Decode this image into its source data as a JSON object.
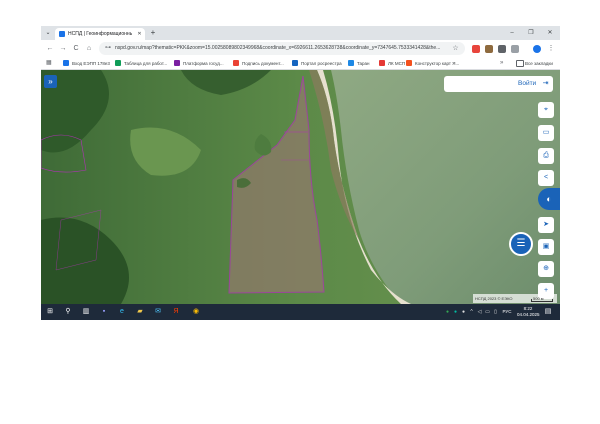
{
  "browser": {
    "tab": {
      "title": "НСПД | Геоинформационный",
      "close": "✕"
    },
    "new_tab": "+",
    "search_tabs": "⌄",
    "window": {
      "minimize": "–",
      "maximize": "❐",
      "close": "✕"
    },
    "nav": {
      "back": "←",
      "forward": "→",
      "reload": "C",
      "home": "⌂"
    },
    "address": {
      "icon": "⊶",
      "url": "nspd.gov.ru/map?thematic=PKK&zoom=15.00258089802349968&coordinate_x=6926611.2653628738&coordinate_y=7347645.7533341428&the...",
      "star": "☆"
    },
    "extensions": [
      "#e8453c",
      "#8e6a3e",
      "#5f6368",
      "#9aa0a6",
      "#1a73e8"
    ],
    "bookmarks": [
      {
        "label": "Вход ЕЭПП 178e3",
        "color": "#1a73e8"
      },
      {
        "label": "Таблица для работ...",
        "color": "#0f9d58"
      },
      {
        "label": "Платформа госуд...",
        "color": "#7b1fa2"
      },
      {
        "label": "Подпись документ...",
        "color": "#ea4335"
      },
      {
        "label": "Портал росреестра",
        "color": "#1565c0"
      },
      {
        "label": "Таран",
        "color": "#1e88e5"
      },
      {
        "label": "ЛК МСП",
        "color": "#e53935"
      },
      {
        "label": "Конструктор карт Я...",
        "color": "#f4511e"
      }
    ],
    "bookmarks_more": "»",
    "other_bookmarks": "Все закладки"
  },
  "map": {
    "expand_icon": "»",
    "login": {
      "label": "Войти",
      "icon": "⇥"
    },
    "tools": [
      {
        "name": "location-tool",
        "icon": "⌖"
      },
      {
        "name": "layers-tool",
        "icon": "▭"
      },
      {
        "name": "print-tool",
        "icon": "⎙"
      },
      {
        "name": "share-tool",
        "icon": "<"
      },
      {
        "name": "navigate-tool",
        "icon": "➤"
      },
      {
        "name": "image-tool",
        "icon": "▣"
      },
      {
        "name": "search-map-tool",
        "icon": "⊕"
      },
      {
        "name": "zoom-in-tool",
        "icon": "+"
      }
    ],
    "chat_icon": "☰",
    "side_panel_icon": "◐",
    "scale_text": "НСПД 2023 © ЕЭКО",
    "scale_label": "500 м"
  },
  "taskbar": {
    "start": "⊞",
    "search": "⚲",
    "apps": [
      {
        "name": "task-view-icon",
        "glyph": "▥",
        "color": "#ffffff"
      },
      {
        "name": "save-app-icon",
        "glyph": "▪",
        "color": "#9aa0ff"
      },
      {
        "name": "edge-icon",
        "glyph": "e",
        "color": "#35c0f5"
      },
      {
        "name": "folder-icon",
        "glyph": "▰",
        "color": "#f2c94c"
      },
      {
        "name": "mail-icon",
        "glyph": "✉",
        "color": "#4fc3f7"
      },
      {
        "name": "yandex-icon",
        "glyph": "Я",
        "color": "#ff3d00"
      },
      {
        "name": "chrome-icon",
        "glyph": "◉",
        "color": "#fbbc05"
      }
    ],
    "tray": [
      {
        "name": "status-green-icon",
        "glyph": "●",
        "color": "#34a853"
      },
      {
        "name": "status-teal-icon",
        "glyph": "●",
        "color": "#00bfa5"
      },
      {
        "name": "status-white-icon",
        "glyph": "●",
        "color": "#e0e0e0"
      },
      {
        "name": "chevron-up-icon",
        "glyph": "^",
        "color": "#e6e6e6"
      },
      {
        "name": "speaker-icon",
        "glyph": "◁",
        "color": "#e6e6e6"
      },
      {
        "name": "network-icon",
        "glyph": "▭",
        "color": "#e6e6e6"
      },
      {
        "name": "battery-icon",
        "glyph": "▯",
        "color": "#e6e6e6"
      }
    ],
    "language": "РУС",
    "time": "8:22",
    "date": "04.04.2025",
    "notifications": "▤"
  }
}
